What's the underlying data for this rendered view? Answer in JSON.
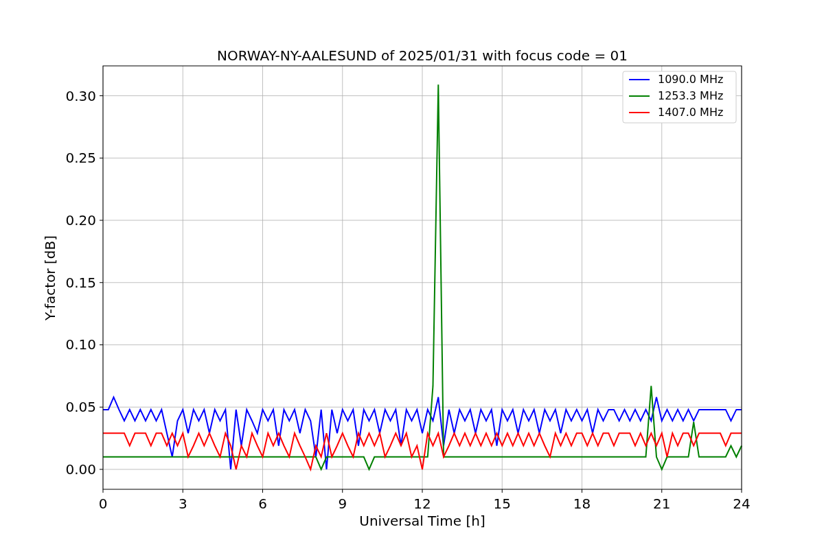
{
  "chart_data": {
    "type": "line",
    "title": "NORWAY-NY-AALESUND of 2025/01/31 with focus code = 01",
    "xlabel": "Universal Time [h]",
    "ylabel": "Y-factor [dB]",
    "grid": true,
    "legend": true,
    "xlim": [
      0,
      24
    ],
    "ylim": [
      -0.016,
      0.324
    ],
    "xticks": [
      0,
      3,
      6,
      9,
      12,
      15,
      18,
      21,
      24
    ],
    "yticks": [
      {
        "value": 0,
        "label": "0.00"
      },
      {
        "value": 0.05,
        "label": "0.05"
      },
      {
        "value": 0.1,
        "label": "0.10"
      },
      {
        "value": 0.15,
        "label": "0.15"
      },
      {
        "value": 0.2,
        "label": "0.20"
      },
      {
        "value": 0.25,
        "label": "0.25"
      },
      {
        "value": 0.3,
        "label": "0.30"
      }
    ],
    "x": [
      0,
      0.2,
      0.4,
      0.6,
      0.8,
      1,
      1.2,
      1.4,
      1.6,
      1.8,
      2,
      2.2,
      2.4,
      2.6,
      2.8,
      3,
      3.2,
      3.4,
      3.6,
      3.8,
      4,
      4.2,
      4.4,
      4.6,
      4.8,
      5,
      5.2,
      5.4,
      5.6,
      5.8,
      6,
      6.2,
      6.4,
      6.6,
      6.8,
      7,
      7.2,
      7.4,
      7.6,
      7.8,
      8,
      8.2,
      8.4,
      8.6,
      8.8,
      9,
      9.2,
      9.4,
      9.6,
      9.8,
      10,
      10.2,
      10.4,
      10.6,
      10.8,
      11,
      11.2,
      11.4,
      11.6,
      11.8,
      12,
      12.2,
      12.4,
      12.6,
      12.8,
      13,
      13.2,
      13.4,
      13.6,
      13.8,
      14,
      14.2,
      14.4,
      14.6,
      14.8,
      15,
      15.2,
      15.4,
      15.6,
      15.8,
      16,
      16.2,
      16.4,
      16.6,
      16.8,
      17,
      17.2,
      17.4,
      17.6,
      17.8,
      18,
      18.2,
      18.4,
      18.6,
      18.8,
      19,
      19.2,
      19.4,
      19.6,
      19.8,
      20,
      20.2,
      20.4,
      20.6,
      20.8,
      21,
      21.2,
      21.4,
      21.6,
      21.8,
      22,
      22.2,
      22.4,
      22.6,
      22.8,
      23,
      23.2,
      23.4,
      23.6,
      23.8,
      24
    ],
    "series": [
      {
        "name": "1090.0 MHz",
        "color": "#0000ff",
        "values": [
          0.048,
          0.048,
          0.058,
          0.048,
          0.039,
          0.048,
          0.039,
          0.048,
          0.039,
          0.048,
          0.039,
          0.048,
          0.029,
          0.01,
          0.039,
          0.048,
          0.029,
          0.048,
          0.039,
          0.048,
          0.029,
          0.048,
          0.039,
          0.048,
          0,
          0.048,
          0.019,
          0.048,
          0.039,
          0.029,
          0.048,
          0.039,
          0.048,
          0.019,
          0.048,
          0.039,
          0.048,
          0.029,
          0.048,
          0.039,
          0.01,
          0.048,
          0,
          0.048,
          0.029,
          0.048,
          0.039,
          0.048,
          0.019,
          0.048,
          0.039,
          0.048,
          0.029,
          0.048,
          0.039,
          0.048,
          0.019,
          0.048,
          0.039,
          0.048,
          0.029,
          0.048,
          0.039,
          0.058,
          0.019,
          0.048,
          0.029,
          0.048,
          0.039,
          0.048,
          0.029,
          0.048,
          0.039,
          0.048,
          0.019,
          0.048,
          0.039,
          0.048,
          0.029,
          0.048,
          0.039,
          0.048,
          0.029,
          0.048,
          0.039,
          0.048,
          0.029,
          0.048,
          0.039,
          0.048,
          0.039,
          0.048,
          0.029,
          0.048,
          0.039,
          0.048,
          0.048,
          0.039,
          0.048,
          0.039,
          0.048,
          0.039,
          0.048,
          0.039,
          0.058,
          0.039,
          0.048,
          0.039,
          0.048,
          0.039,
          0.048,
          0.039,
          0.048,
          0.048,
          0.048,
          0.048,
          0.048,
          0.048,
          0.039,
          0.048,
          0.048
        ]
      },
      {
        "name": "1253.3 MHz",
        "color": "#008000",
        "values": [
          0.01,
          0.01,
          0.01,
          0.01,
          0.01,
          0.01,
          0.01,
          0.01,
          0.01,
          0.01,
          0.01,
          0.01,
          0.01,
          0.01,
          0.01,
          0.01,
          0.01,
          0.01,
          0.01,
          0.01,
          0.01,
          0.01,
          0.01,
          0.01,
          0.01,
          0.01,
          0.01,
          0.01,
          0.01,
          0.01,
          0.01,
          0.01,
          0.01,
          0.01,
          0.01,
          0.01,
          0.01,
          0.01,
          0.01,
          0.01,
          0.01,
          0,
          0.01,
          0.01,
          0.01,
          0.01,
          0.01,
          0.01,
          0.01,
          0.01,
          0,
          0.01,
          0.01,
          0.01,
          0.01,
          0.01,
          0.01,
          0.01,
          0.01,
          0.01,
          0.01,
          0.01,
          0.067,
          0.309,
          0.01,
          0.01,
          0.01,
          0.01,
          0.01,
          0.01,
          0.01,
          0.01,
          0.01,
          0.01,
          0.01,
          0.01,
          0.01,
          0.01,
          0.01,
          0.01,
          0.01,
          0.01,
          0.01,
          0.01,
          0.01,
          0.01,
          0.01,
          0.01,
          0.01,
          0.01,
          0.01,
          0.01,
          0.01,
          0.01,
          0.01,
          0.01,
          0.01,
          0.01,
          0.01,
          0.01,
          0.01,
          0.01,
          0.01,
          0.067,
          0.01,
          0,
          0.01,
          0.01,
          0.01,
          0.01,
          0.01,
          0.038,
          0.01,
          0.01,
          0.01,
          0.01,
          0.01,
          0.01,
          0.019,
          0.01,
          0.019
        ]
      },
      {
        "name": "1407.0 MHz",
        "color": "#ff0000",
        "values": [
          0.029,
          0.029,
          0.029,
          0.029,
          0.029,
          0.019,
          0.029,
          0.029,
          0.029,
          0.019,
          0.029,
          0.029,
          0.019,
          0.029,
          0.019,
          0.029,
          0.01,
          0.019,
          0.029,
          0.019,
          0.029,
          0.019,
          0.01,
          0.029,
          0.019,
          0,
          0.019,
          0.01,
          0.029,
          0.019,
          0.01,
          0.029,
          0.019,
          0.029,
          0.019,
          0.01,
          0.029,
          0.019,
          0.01,
          0,
          0.019,
          0.01,
          0.029,
          0.01,
          0.019,
          0.029,
          0.019,
          0.01,
          0.029,
          0.019,
          0.029,
          0.019,
          0.029,
          0.01,
          0.019,
          0.029,
          0.019,
          0.029,
          0.01,
          0.019,
          0,
          0.029,
          0.019,
          0.029,
          0.01,
          0.019,
          0.029,
          0.019,
          0.029,
          0.019,
          0.029,
          0.019,
          0.029,
          0.019,
          0.029,
          0.019,
          0.029,
          0.019,
          0.029,
          0.019,
          0.029,
          0.019,
          0.029,
          0.019,
          0.01,
          0.029,
          0.019,
          0.029,
          0.019,
          0.029,
          0.029,
          0.019,
          0.029,
          0.019,
          0.029,
          0.029,
          0.019,
          0.029,
          0.029,
          0.029,
          0.019,
          0.029,
          0.019,
          0.029,
          0.019,
          0.029,
          0.01,
          0.029,
          0.019,
          0.029,
          0.029,
          0.019,
          0.029,
          0.029,
          0.029,
          0.029,
          0.029,
          0.019,
          0.029,
          0.029,
          0.029
        ]
      }
    ]
  }
}
